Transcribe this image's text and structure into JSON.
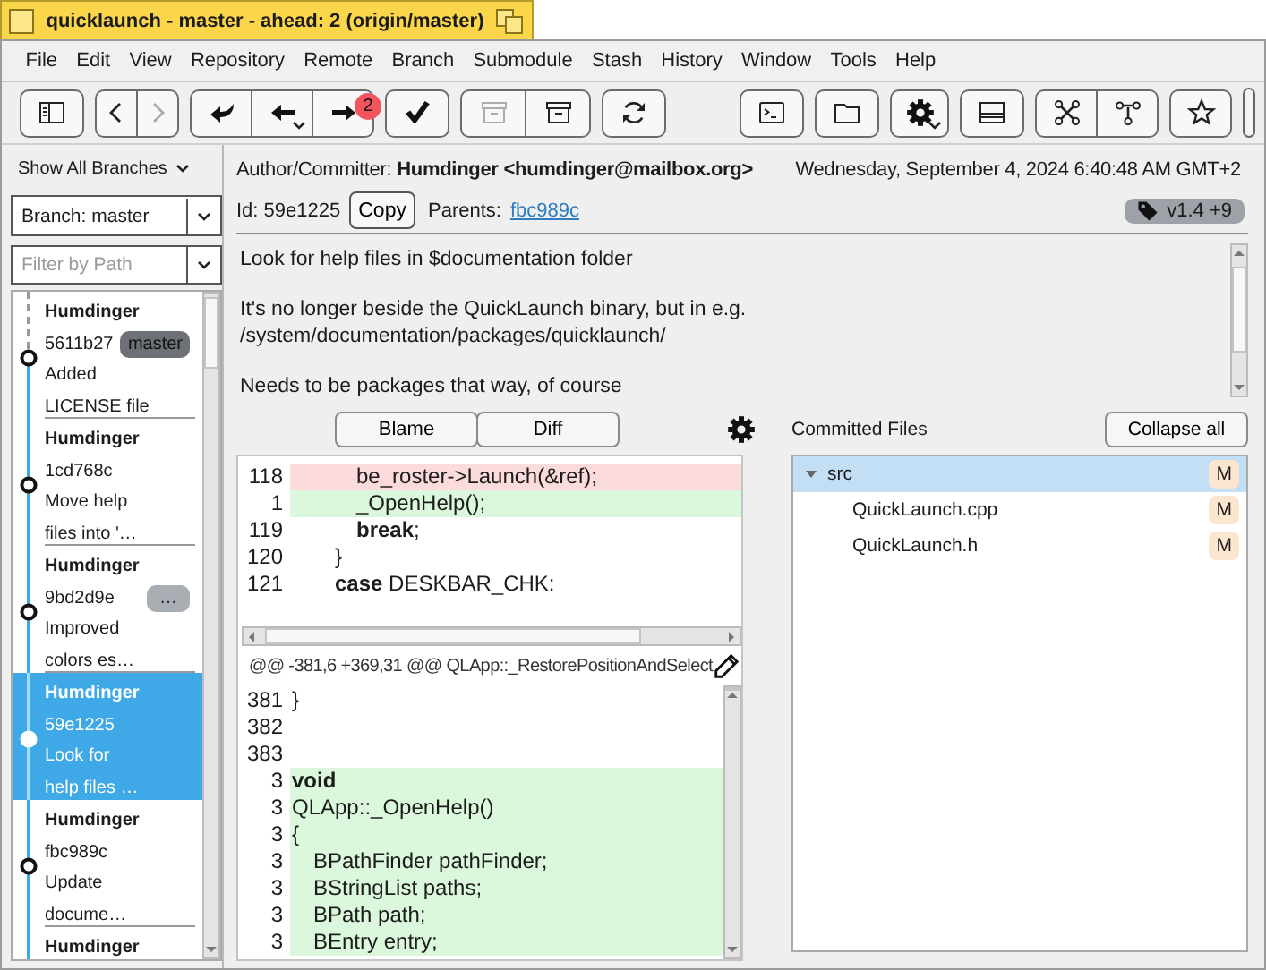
{
  "window": {
    "title": "quicklaunch - master - ahead: 2 (origin/master)"
  },
  "menu": [
    "File",
    "Edit",
    "View",
    "Repository",
    "Remote",
    "Branch",
    "Submodule",
    "Stash",
    "History",
    "Window",
    "Tools",
    "Help"
  ],
  "toolbar": {
    "left": [
      [
        {
          "disabled": false,
          "dropdown": false
        }
      ],
      [
        {
          "disabled": false,
          "dropdown": false
        },
        {
          "disabled": true,
          "dropdown": false
        }
      ],
      [
        {
          "disabled": false,
          "dropdown": false
        },
        {
          "disabled": false,
          "dropdown": true
        },
        {
          "disabled": false,
          "dropdown": false,
          "badge": "2"
        }
      ],
      [
        {
          "disabled": false,
          "dropdown": false
        }
      ],
      [
        {
          "disabled": true,
          "dropdown": false
        },
        {
          "disabled": false,
          "dropdown": false
        }
      ],
      [
        {
          "disabled": false,
          "dropdown": false
        }
      ]
    ],
    "right": [
      [
        {
          "disabled": false,
          "dropdown": false
        }
      ],
      [
        {
          "disabled": false,
          "dropdown": false
        }
      ],
      [
        {
          "disabled": false,
          "dropdown": true
        }
      ],
      [
        {
          "disabled": false,
          "dropdown": false
        }
      ],
      [
        {
          "disabled": false,
          "dropdown": false
        },
        {
          "disabled": false,
          "dropdown": false
        }
      ],
      [
        {
          "disabled": false,
          "dropdown": false
        }
      ]
    ]
  },
  "sidebar": {
    "branch_filter": "Show All Branches",
    "branch_combo": "Branch: master",
    "path_filter": {
      "placeholder": "Filter by Path"
    }
  },
  "commits": [
    {
      "author": "Humdinger",
      "hash": "5611b27",
      "badge": {
        "text": "master",
        "kind": "branch"
      },
      "message": "Added\nLICENSE file",
      "selected": false
    },
    {
      "author": "Humdinger",
      "hash": "1cd768c",
      "message": "Move help\nfiles into '…",
      "selected": false
    },
    {
      "author": "Humdinger",
      "hash": "9bd2d9e",
      "badge": {
        "text": "…",
        "kind": "more"
      },
      "message": "Improved\ncolors es…",
      "selected": false
    },
    {
      "author": "Humdinger",
      "hash": "59e1225",
      "message": "Look for\nhelp files …",
      "selected": true
    },
    {
      "author": "Humdinger",
      "hash": "fbc989c",
      "message": "Update\ndocume…",
      "selected": false
    },
    {
      "author": "Humdinger",
      "selected": false
    }
  ],
  "details": {
    "author_line": "Author/Committer: **Humdinger <humdinger@mailbox.org>**",
    "date": "Wednesday, September 4, 2024 6:40:48 AM GMT+2",
    "id": "Id: 59e1225",
    "copy_button": "Copy",
    "parents_label": "Parents:",
    "parent_link": "fbc989c",
    "tag": "v1.4 +9",
    "message": "Look for help files in $documentation folder\n\nIt's no longer beside the QuickLaunch binary, but in e.g.\n/system/documentation/packages/quicklaunch/\n\nNeeds to be packages that way, of course"
  },
  "diff": {
    "buttons": [
      "Blame",
      "Diff"
    ],
    "upper_lines": [
      {
        "number": "118",
        "kind": "removed",
        "code": "\t\t\tbe_roster->Launch(&ref);"
      },
      {
        "number": "1",
        "kind": "added",
        "code": "\t\t\t_OpenHelp();"
      },
      {
        "number": "119",
        "kind": "context",
        "code": "\t\t\t**break**;"
      },
      {
        "number": "120",
        "kind": "context",
        "code": "\t\t}"
      },
      {
        "number": "121",
        "kind": "context",
        "code": "\t\t**case** DESKBAR_CHK:"
      }
    ],
    "hunk_header": "@@ -381,6 +369,31 @@ QLApp::_RestorePositionAndSelect",
    "lower_lines": [
      {
        "number": "381",
        "kind": "context",
        "code": "}"
      },
      {
        "number": "382",
        "kind": "context"
      },
      {
        "number": "383",
        "kind": "context"
      },
      {
        "number": "3",
        "kind": "added",
        "code": "**void**"
      },
      {
        "number": "3",
        "kind": "added",
        "code": "QLApp::_OpenHelp()"
      },
      {
        "number": "3",
        "kind": "added",
        "code": "{"
      },
      {
        "number": "3",
        "kind": "added",
        "code": "\tBPathFinder pathFinder;"
      },
      {
        "number": "3",
        "kind": "added",
        "code": "\tBStringList paths;"
      },
      {
        "number": "3",
        "kind": "added",
        "code": "\tBPath path;"
      },
      {
        "number": "3",
        "kind": "added",
        "code": "\tBEntry entry;"
      }
    ]
  },
  "files": {
    "title": "Committed Files",
    "collapse_button": "Collapse all",
    "tree": [
      {
        "name": "src",
        "status": "M",
        "expanded": true,
        "selected": true,
        "children": [
          {
            "name": "QuickLaunch.cpp",
            "status": "M",
            "selected": false
          },
          {
            "name": "QuickLaunch.h",
            "status": "M",
            "selected": false
          }
        ]
      }
    ]
  }
}
